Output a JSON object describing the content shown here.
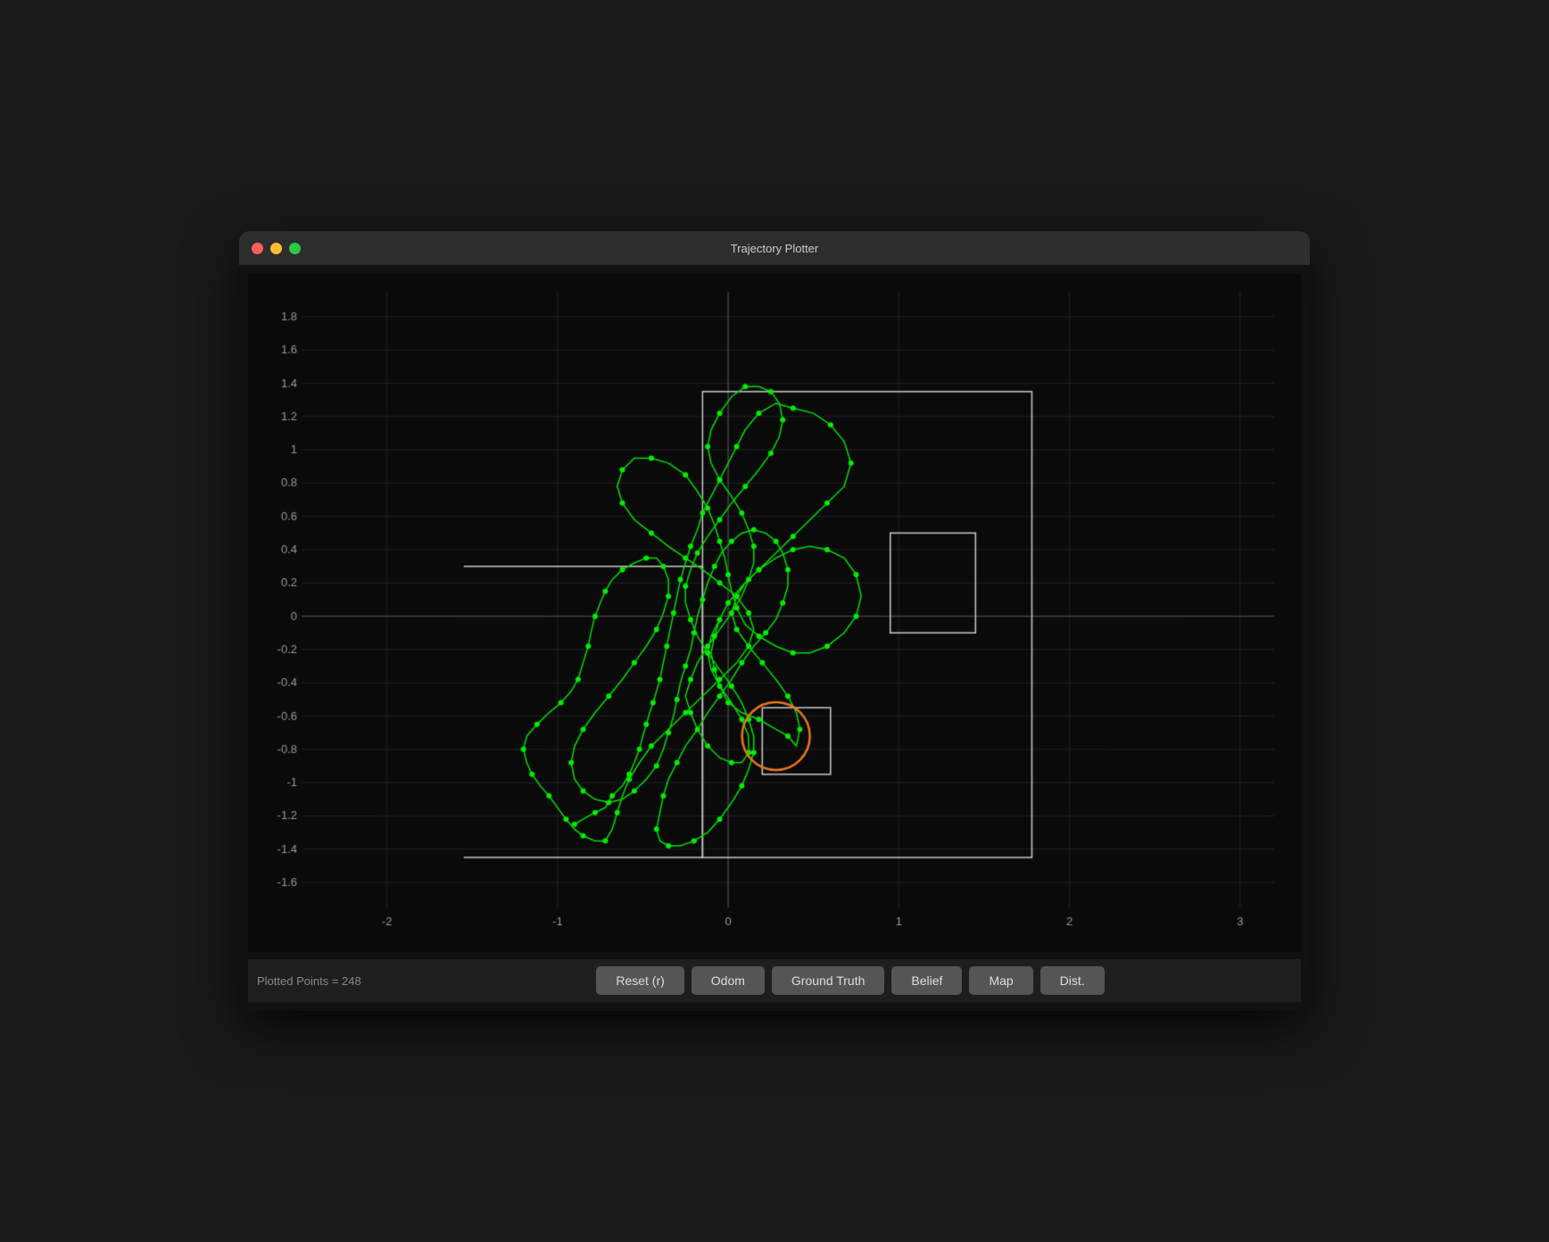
{
  "window": {
    "title": "Trajectory Plotter"
  },
  "plot": {
    "x_axis": {
      "min": -2,
      "max": 3,
      "ticks": [
        -2,
        -1,
        0,
        1,
        2,
        3
      ]
    },
    "y_axis": {
      "min": -1.6,
      "max": 1.8,
      "ticks": [
        1.8,
        1.6,
        1.4,
        1.2,
        1.0,
        0.8,
        0.6,
        0.4,
        0.2,
        0,
        -0.2,
        -0.4,
        -0.6,
        -0.8,
        -1.0,
        -1.2,
        -1.4,
        -1.6
      ]
    }
  },
  "bottom_bar": {
    "points_label": "Plotted Points = 248",
    "buttons": [
      {
        "id": "reset",
        "label": "Reset (r)"
      },
      {
        "id": "odom",
        "label": "Odom"
      },
      {
        "id": "ground-truth",
        "label": "Ground Truth"
      },
      {
        "id": "belief",
        "label": "Belief"
      },
      {
        "id": "map",
        "label": "Map"
      },
      {
        "id": "dist",
        "label": "Dist."
      }
    ]
  },
  "colors": {
    "background": "#0a0a0a",
    "grid": "#2a2a2a",
    "axis": "#444444",
    "trajectory": "#00ee00",
    "circle": "#e87820",
    "rect_border": "#cccccc",
    "text": "#aaaaaa"
  }
}
